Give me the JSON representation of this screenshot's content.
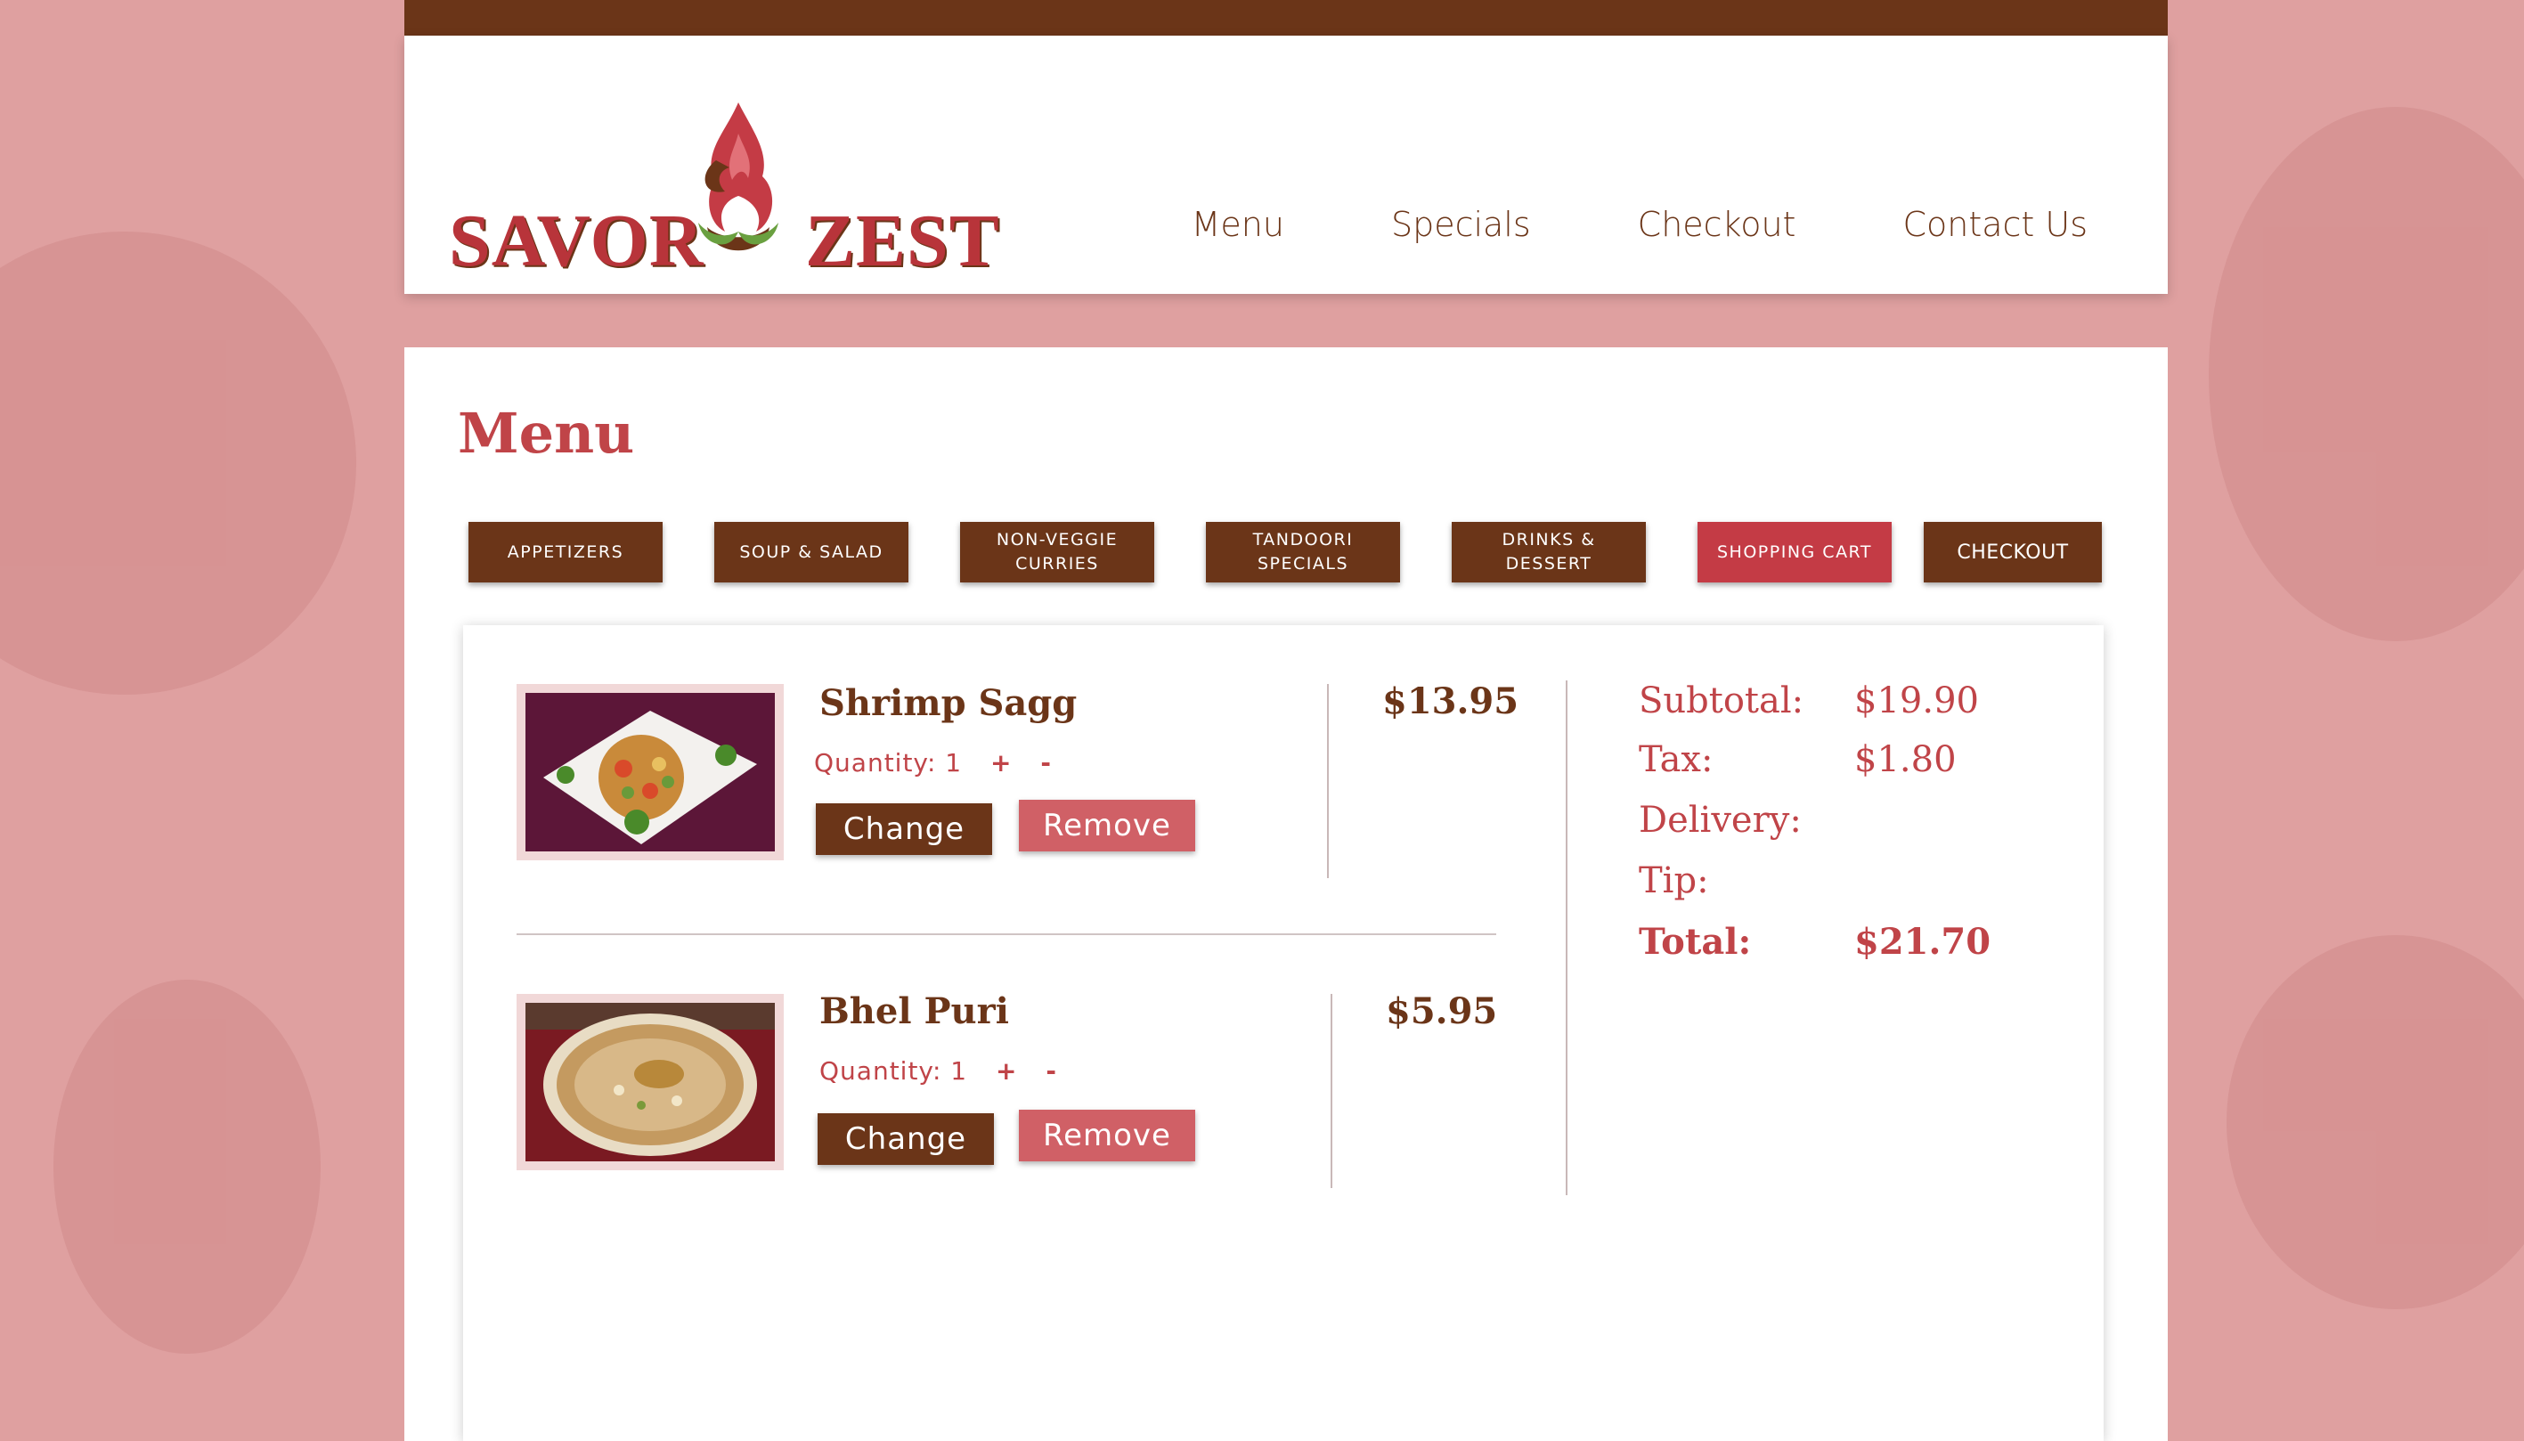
{
  "colors": {
    "brand_brown": "#6b3518",
    "brand_red": "#c43b45",
    "remove_red": "#d06066",
    "background_pink": "#dfa0a0"
  },
  "logo": {
    "left_word": "SAVOR",
    "right_word": "ZEST",
    "icon": "flame-ampersand-icon"
  },
  "nav": {
    "items": [
      "Menu",
      "Specials",
      "Checkout",
      "Contact Us"
    ]
  },
  "page": {
    "title": "Menu"
  },
  "categories": [
    {
      "label": "APPETIZERS"
    },
    {
      "label": "SOUP & SALAD"
    },
    {
      "label": "NON-VEGGIE CURRIES"
    },
    {
      "label": "TANDOORI SPECIALS"
    },
    {
      "label": "DRINKS & DESSERT"
    },
    {
      "label": "SHOPPING CART"
    },
    {
      "label": "CHECKOUT"
    }
  ],
  "cart": {
    "items": [
      {
        "name": "Shrimp Sagg",
        "quantity_label": "Quantity: 1",
        "plus": "+",
        "minus": "-",
        "change_label": "Change",
        "remove_label": "Remove",
        "price": "$13.95"
      },
      {
        "name": "Bhel Puri",
        "quantity_label": "Quantity: 1",
        "plus": "+",
        "minus": "-",
        "change_label": "Change",
        "remove_label": "Remove",
        "price": "$5.95"
      }
    ],
    "summary": {
      "subtotal_label": "Subtotal:",
      "subtotal_value": "$19.90",
      "tax_label": "Tax:",
      "tax_value": "$1.80",
      "delivery_label": "Delivery:",
      "tip_label": "Tip:",
      "total_label": "Total:",
      "total_value": "$21.70"
    }
  }
}
